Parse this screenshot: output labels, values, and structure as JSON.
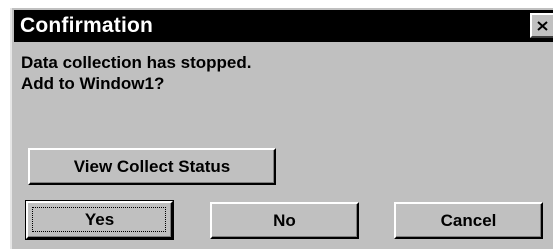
{
  "window": {
    "title": "Confirmation",
    "close_icon": "close-icon"
  },
  "message": {
    "line1": "Data collection has stopped.",
    "line2": "Add to Window1?"
  },
  "buttons": {
    "view_collect_status": "View Collect Status",
    "yes": "Yes",
    "no": "No",
    "cancel": "Cancel"
  },
  "colors": {
    "dialog_face": "#c0c0c0",
    "titlebar": "#000000",
    "title_text": "#ffffff"
  }
}
